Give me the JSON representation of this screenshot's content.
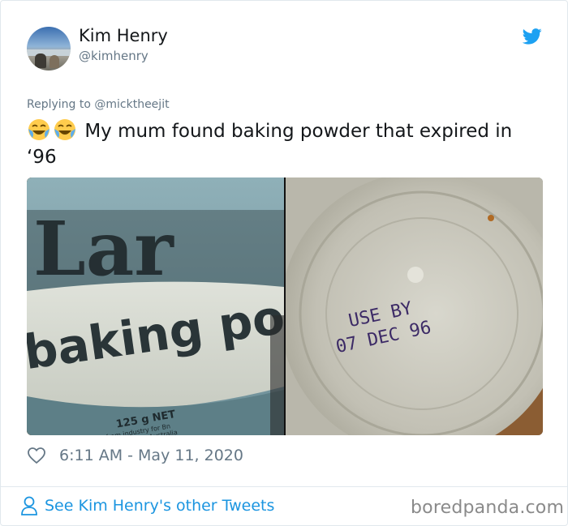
{
  "author": {
    "name": "Kim Henry",
    "handle": "@kimhenry"
  },
  "reply": {
    "text": "Replying to @micktheejit"
  },
  "tweet": {
    "emojis": [
      "joy-emoji",
      "joy-emoji"
    ],
    "text": "My mum found baking powder that expired in ‘96"
  },
  "media": {
    "left": {
      "label_top": "Lar",
      "label_main": "baking powder",
      "label_weight": "125 g NET",
      "label_small_1": "from industry for Bn",
      "label_small_2": "Proudly Australia"
    },
    "right": {
      "stamp_line_1": "USE BY",
      "stamp_line_2": "07 DEC 96"
    }
  },
  "meta": {
    "timestamp": "6:11 AM - May 11, 2020"
  },
  "footer": {
    "see_more": "See Kim Henry's other Tweets"
  },
  "watermark": "boredpanda.com",
  "colors": {
    "twitter_blue": "#1da1f2",
    "link_blue": "#1b95e0",
    "secondary_text": "#657786"
  },
  "icons": {
    "brand": "twitter-bird-icon",
    "like": "heart-icon",
    "profile": "person-icon"
  }
}
